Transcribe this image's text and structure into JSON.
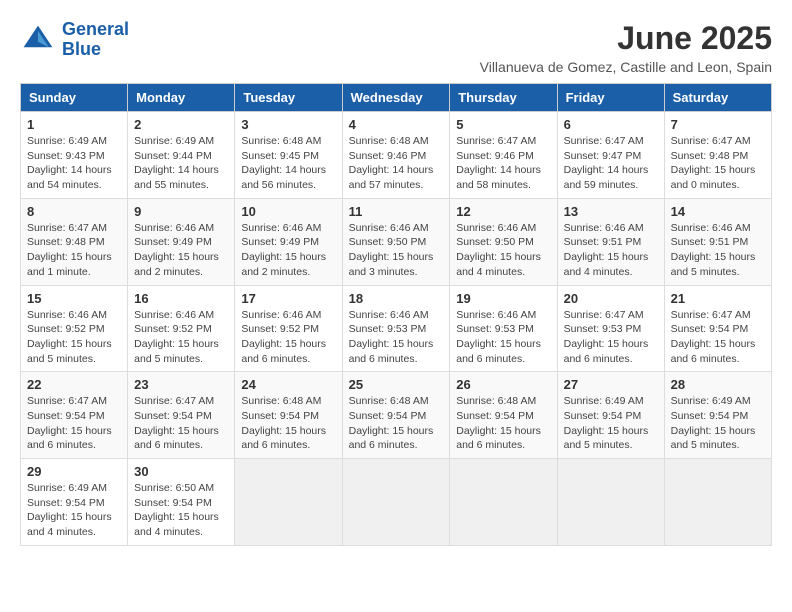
{
  "header": {
    "logo_line1": "General",
    "logo_line2": "Blue",
    "month_year": "June 2025",
    "location": "Villanueva de Gomez, Castille and Leon, Spain"
  },
  "weekdays": [
    "Sunday",
    "Monday",
    "Tuesday",
    "Wednesday",
    "Thursday",
    "Friday",
    "Saturday"
  ],
  "weeks": [
    [
      {
        "day": "1",
        "info": "Sunrise: 6:49 AM\nSunset: 9:43 PM\nDaylight: 14 hours\nand 54 minutes."
      },
      {
        "day": "2",
        "info": "Sunrise: 6:49 AM\nSunset: 9:44 PM\nDaylight: 14 hours\nand 55 minutes."
      },
      {
        "day": "3",
        "info": "Sunrise: 6:48 AM\nSunset: 9:45 PM\nDaylight: 14 hours\nand 56 minutes."
      },
      {
        "day": "4",
        "info": "Sunrise: 6:48 AM\nSunset: 9:46 PM\nDaylight: 14 hours\nand 57 minutes."
      },
      {
        "day": "5",
        "info": "Sunrise: 6:47 AM\nSunset: 9:46 PM\nDaylight: 14 hours\nand 58 minutes."
      },
      {
        "day": "6",
        "info": "Sunrise: 6:47 AM\nSunset: 9:47 PM\nDaylight: 14 hours\nand 59 minutes."
      },
      {
        "day": "7",
        "info": "Sunrise: 6:47 AM\nSunset: 9:48 PM\nDaylight: 15 hours\nand 0 minutes."
      }
    ],
    [
      {
        "day": "8",
        "info": "Sunrise: 6:47 AM\nSunset: 9:48 PM\nDaylight: 15 hours\nand 1 minute."
      },
      {
        "day": "9",
        "info": "Sunrise: 6:46 AM\nSunset: 9:49 PM\nDaylight: 15 hours\nand 2 minutes."
      },
      {
        "day": "10",
        "info": "Sunrise: 6:46 AM\nSunset: 9:49 PM\nDaylight: 15 hours\nand 2 minutes."
      },
      {
        "day": "11",
        "info": "Sunrise: 6:46 AM\nSunset: 9:50 PM\nDaylight: 15 hours\nand 3 minutes."
      },
      {
        "day": "12",
        "info": "Sunrise: 6:46 AM\nSunset: 9:50 PM\nDaylight: 15 hours\nand 4 minutes."
      },
      {
        "day": "13",
        "info": "Sunrise: 6:46 AM\nSunset: 9:51 PM\nDaylight: 15 hours\nand 4 minutes."
      },
      {
        "day": "14",
        "info": "Sunrise: 6:46 AM\nSunset: 9:51 PM\nDaylight: 15 hours\nand 5 minutes."
      }
    ],
    [
      {
        "day": "15",
        "info": "Sunrise: 6:46 AM\nSunset: 9:52 PM\nDaylight: 15 hours\nand 5 minutes."
      },
      {
        "day": "16",
        "info": "Sunrise: 6:46 AM\nSunset: 9:52 PM\nDaylight: 15 hours\nand 5 minutes."
      },
      {
        "day": "17",
        "info": "Sunrise: 6:46 AM\nSunset: 9:52 PM\nDaylight: 15 hours\nand 6 minutes."
      },
      {
        "day": "18",
        "info": "Sunrise: 6:46 AM\nSunset: 9:53 PM\nDaylight: 15 hours\nand 6 minutes."
      },
      {
        "day": "19",
        "info": "Sunrise: 6:46 AM\nSunset: 9:53 PM\nDaylight: 15 hours\nand 6 minutes."
      },
      {
        "day": "20",
        "info": "Sunrise: 6:47 AM\nSunset: 9:53 PM\nDaylight: 15 hours\nand 6 minutes."
      },
      {
        "day": "21",
        "info": "Sunrise: 6:47 AM\nSunset: 9:54 PM\nDaylight: 15 hours\nand 6 minutes."
      }
    ],
    [
      {
        "day": "22",
        "info": "Sunrise: 6:47 AM\nSunset: 9:54 PM\nDaylight: 15 hours\nand 6 minutes."
      },
      {
        "day": "23",
        "info": "Sunrise: 6:47 AM\nSunset: 9:54 PM\nDaylight: 15 hours\nand 6 minutes."
      },
      {
        "day": "24",
        "info": "Sunrise: 6:48 AM\nSunset: 9:54 PM\nDaylight: 15 hours\nand 6 minutes."
      },
      {
        "day": "25",
        "info": "Sunrise: 6:48 AM\nSunset: 9:54 PM\nDaylight: 15 hours\nand 6 minutes."
      },
      {
        "day": "26",
        "info": "Sunrise: 6:48 AM\nSunset: 9:54 PM\nDaylight: 15 hours\nand 6 minutes."
      },
      {
        "day": "27",
        "info": "Sunrise: 6:49 AM\nSunset: 9:54 PM\nDaylight: 15 hours\nand 5 minutes."
      },
      {
        "day": "28",
        "info": "Sunrise: 6:49 AM\nSunset: 9:54 PM\nDaylight: 15 hours\nand 5 minutes."
      }
    ],
    [
      {
        "day": "29",
        "info": "Sunrise: 6:49 AM\nSunset: 9:54 PM\nDaylight: 15 hours\nand 4 minutes."
      },
      {
        "day": "30",
        "info": "Sunrise: 6:50 AM\nSunset: 9:54 PM\nDaylight: 15 hours\nand 4 minutes."
      },
      null,
      null,
      null,
      null,
      null
    ]
  ]
}
